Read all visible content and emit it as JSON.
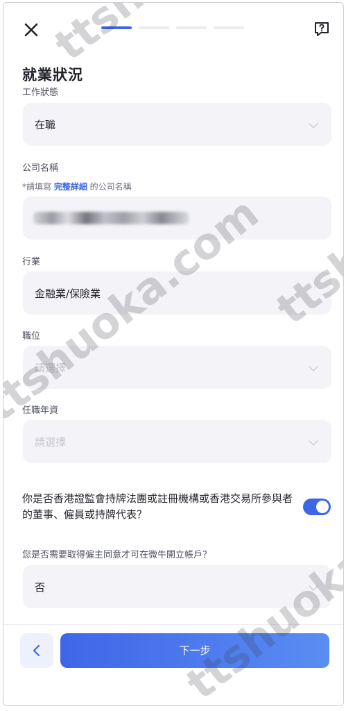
{
  "header": {
    "progress_steps": 4,
    "progress_active": 1
  },
  "page_title": "就業狀況",
  "fields": {
    "work_status": {
      "label": "工作狀態",
      "value": "在職"
    },
    "company_name": {
      "label": "公司名稱",
      "hint_prefix": "*請填寫 ",
      "hint_strong": "完整詳細",
      "hint_suffix": " 的公司名稱"
    },
    "industry": {
      "label": "行業",
      "value": "金融業/保險業"
    },
    "position": {
      "label": "職位",
      "placeholder": "請選擇"
    },
    "years": {
      "label": "任職年資",
      "placeholder": "請選擇"
    },
    "sfc_question": {
      "text": "你是否香港證監會持牌法團或註冊機構或香港交易所參與者的董事、僱員或持牌代表？",
      "toggle_on": true
    },
    "consent": {
      "label": "您是否需要取得僱主同意才可在微牛開立帳戶？",
      "value": "否"
    }
  },
  "footer": {
    "next_label": "下一步"
  },
  "colors": {
    "accent": "#3e67e6",
    "field_bg": "#f4f4f8"
  },
  "watermarks": [
    "ttshuoka.com",
    "ttshuoka.com",
    "ttshuoka.com",
    "ttshuoka.com"
  ]
}
